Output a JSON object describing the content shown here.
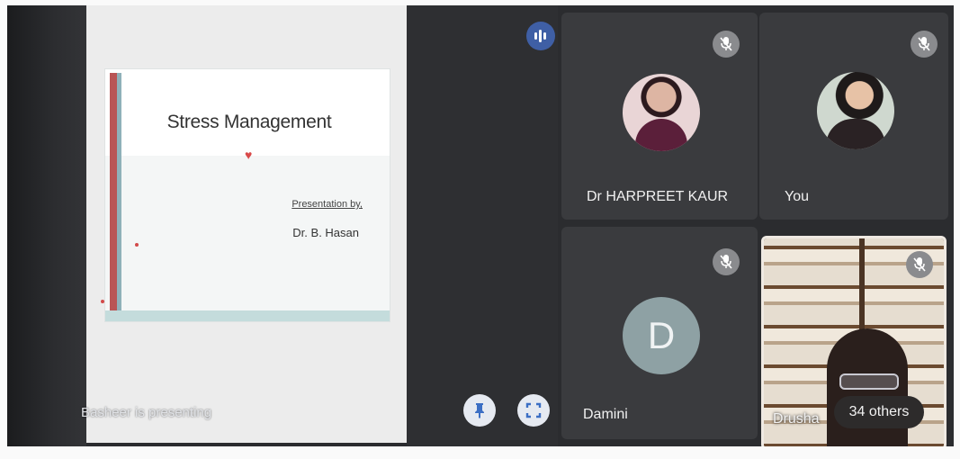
{
  "slide": {
    "title": "Stress Management",
    "presented_by": "Presentation by,",
    "author": "Dr. B. Hasan"
  },
  "presenter_label": "Basheer is presenting",
  "controls": {
    "pin_icon": "pin-icon",
    "fullscreen_icon": "fullscreen-icon",
    "audio_icon": "audio-level-icon"
  },
  "participants": [
    {
      "name": "Dr HARPREET KAUR",
      "muted": true,
      "avatar": "photo"
    },
    {
      "name": "You",
      "muted": true,
      "avatar": "photo"
    },
    {
      "name": "Damini",
      "muted": true,
      "avatar": "letter",
      "initial": "D"
    },
    {
      "name": "Drusha",
      "muted": true,
      "avatar": "video"
    }
  ],
  "others_count": "34 others",
  "colors": {
    "accent_blue": "#3f5fa5",
    "tile_bg": "#3a3b3e",
    "letter_avatar": "#8ea1a4"
  }
}
